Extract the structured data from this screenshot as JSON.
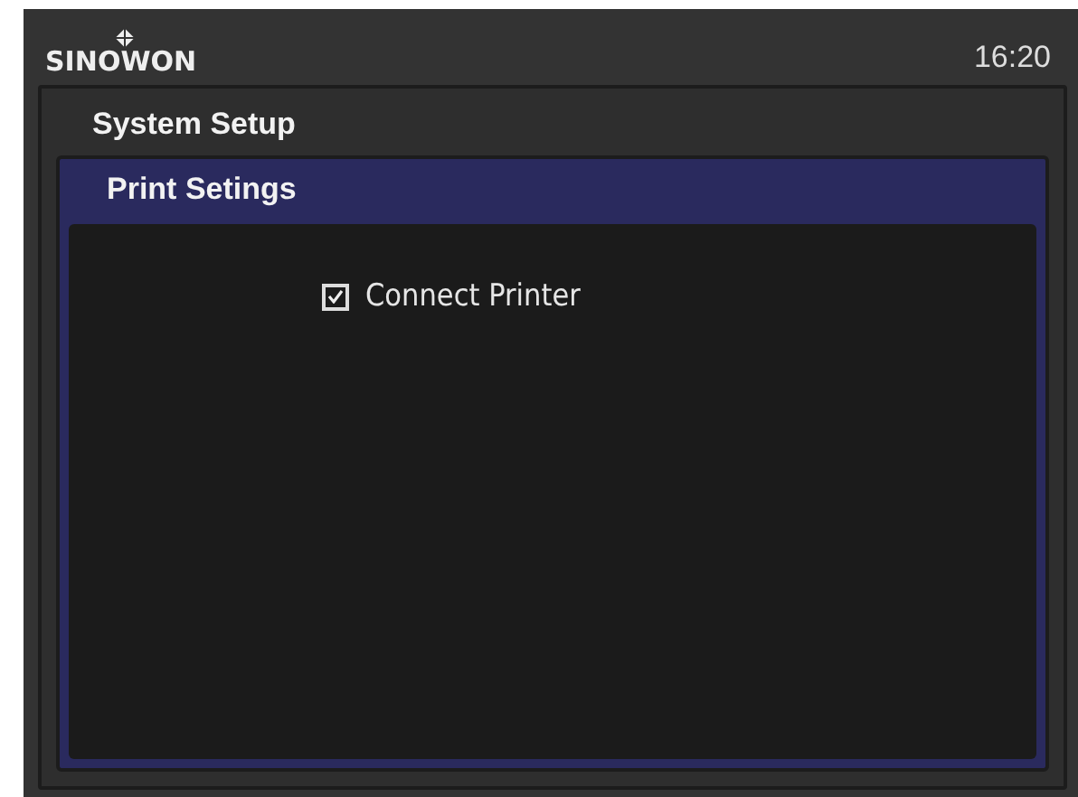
{
  "header": {
    "logo": "SINOWON",
    "time": "16:20"
  },
  "panel": {
    "title": "System Setup"
  },
  "subpanel": {
    "title": "Print Setings"
  },
  "options": [
    {
      "kind": "checkbox",
      "label": "Connect Printer",
      "checked": true
    }
  ]
}
